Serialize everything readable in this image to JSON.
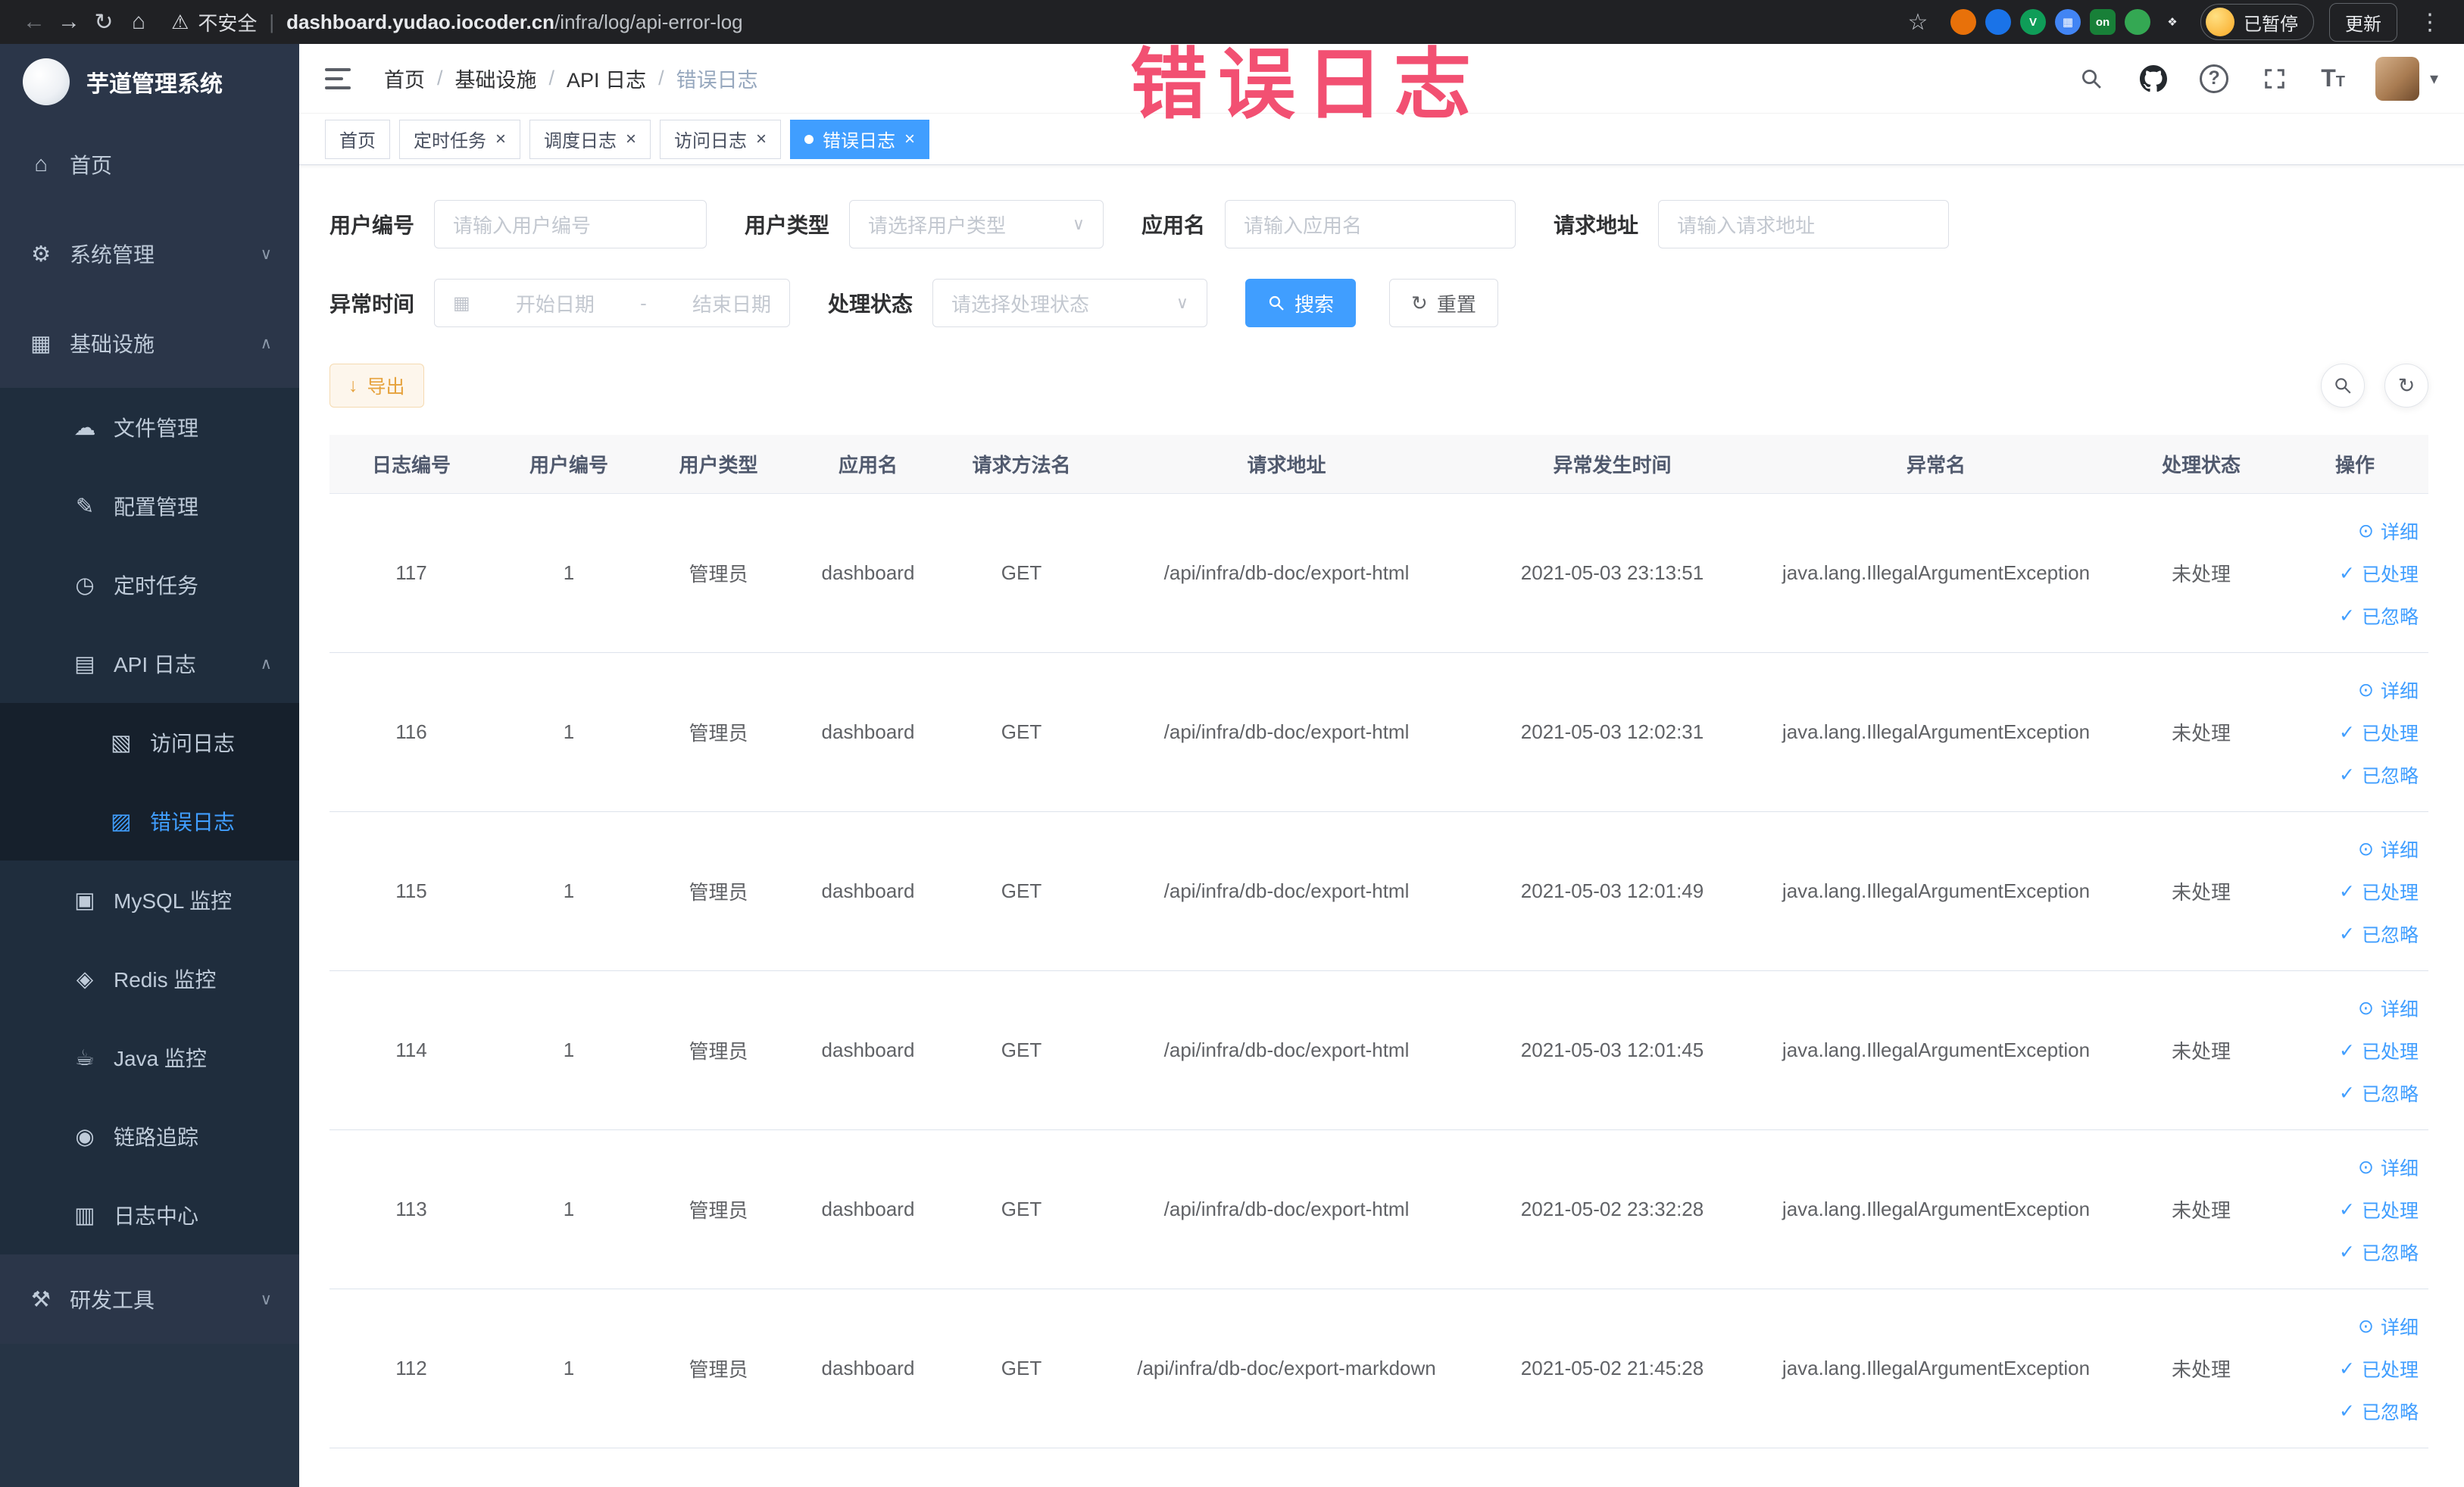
{
  "annotation": {
    "text": "错误日志"
  },
  "colors": {
    "primary": "#409EFF",
    "warning": "#E6A23C",
    "annotation": "#f25072"
  },
  "browser": {
    "security_label": "不安全",
    "url_domain": "dashboard.yudao.iocoder.cn",
    "url_path": "/infra/log/api-error-log",
    "paused_label": "已暂停",
    "update_label": "更新",
    "extensions": [
      {
        "name": "extension-orange-icon",
        "color": "#e8710a",
        "glyph": ""
      },
      {
        "name": "extension-blue-drop-icon",
        "color": "#1a73e8",
        "glyph": ""
      },
      {
        "name": "extension-green-v-icon",
        "color": "#0f9d58",
        "glyph": "V"
      },
      {
        "name": "extension-grid-icon",
        "color": "#4285f4",
        "glyph": "▦"
      },
      {
        "name": "extension-on-badge-icon",
        "color": "#188038",
        "glyph": "on",
        "shape": "square"
      },
      {
        "name": "extension-leaf-icon",
        "color": "#34a853",
        "glyph": ""
      },
      {
        "name": "extension-puzzle-icon",
        "color": "transparent",
        "glyph": "❖",
        "fg": "#e8eaed"
      }
    ]
  },
  "sidebar": {
    "logo_title": "芋道管理系统",
    "icon_glyphs": {
      "home-icon": "⌂",
      "gear-icon": "⚙",
      "infra-icon": "▦",
      "file-icon": "☁",
      "config-icon": "✎",
      "timer-icon": "◷",
      "api-log-icon": "▤",
      "access-log-icon": "▧",
      "error-log-icon": "▨",
      "mysql-icon": "▣",
      "redis-icon": "◈",
      "java-icon": "☕",
      "trace-icon": "◉",
      "logcenter-icon": "▥",
      "devtool-icon": "⚒"
    },
    "menu": [
      {
        "key": "home",
        "label": "首页",
        "icon": "home-icon",
        "level": 0
      },
      {
        "key": "system-mgmt",
        "label": "系统管理",
        "icon": "gear-icon",
        "level": 0,
        "chevron": "down"
      },
      {
        "key": "infrastructure",
        "label": "基础设施",
        "icon": "infra-icon",
        "level": 0,
        "chevron": "up"
      },
      {
        "key": "file-mgmt",
        "label": "文件管理",
        "icon": "file-icon",
        "level": 1
      },
      {
        "key": "config-mgmt",
        "label": "配置管理",
        "icon": "config-icon",
        "level": 1
      },
      {
        "key": "cron-job",
        "label": "定时任务",
        "icon": "timer-icon",
        "level": 1
      },
      {
        "key": "api-log",
        "label": "API 日志",
        "icon": "api-log-icon",
        "level": 1,
        "chevron": "up"
      },
      {
        "key": "access-log",
        "label": "访问日志",
        "icon": "access-log-icon",
        "level": 2
      },
      {
        "key": "error-log",
        "label": "错误日志",
        "icon": "error-log-icon",
        "level": 2,
        "active": true
      },
      {
        "key": "mysql-monitor",
        "label": "MySQL 监控",
        "icon": "mysql-icon",
        "level": 1
      },
      {
        "key": "redis-monitor",
        "label": "Redis 监控",
        "icon": "redis-icon",
        "level": 1
      },
      {
        "key": "java-monitor",
        "label": "Java 监控",
        "icon": "java-icon",
        "level": 1
      },
      {
        "key": "link-trace",
        "label": "链路追踪",
        "icon": "trace-icon",
        "level": 1
      },
      {
        "key": "log-center",
        "label": "日志中心",
        "icon": "logcenter-icon",
        "level": 1
      },
      {
        "key": "dev-tools",
        "label": "研发工具",
        "icon": "devtool-icon",
        "level": 0,
        "chevron": "down"
      }
    ]
  },
  "header": {
    "breadcrumb": [
      "首页",
      "基础设施",
      "API 日志",
      "错误日志"
    ]
  },
  "tabs": [
    {
      "key": "home",
      "label": "首页",
      "closable": false
    },
    {
      "key": "cron-job",
      "label": "定时任务",
      "closable": true
    },
    {
      "key": "schedule-log",
      "label": "调度日志",
      "closable": true
    },
    {
      "key": "access-log",
      "label": "访问日志",
      "closable": true
    },
    {
      "key": "error-log",
      "label": "错误日志",
      "closable": true,
      "active": true
    }
  ],
  "filters": {
    "user_id": {
      "label": "用户编号",
      "placeholder": "请输入用户编号"
    },
    "user_type": {
      "label": "用户类型",
      "placeholder": "请选择用户类型"
    },
    "app_name": {
      "label": "应用名",
      "placeholder": "请输入应用名"
    },
    "request_url": {
      "label": "请求地址",
      "placeholder": "请输入请求地址"
    },
    "exception_time": {
      "label": "异常时间",
      "start_placeholder": "开始日期",
      "separator": "-",
      "end_placeholder": "结束日期"
    },
    "process_status": {
      "label": "处理状态",
      "placeholder": "请选择处理状态"
    },
    "search_label": "搜索",
    "reset_label": "重置"
  },
  "toolbar": {
    "export_label": "导出"
  },
  "table": {
    "columns": [
      "日志编号",
      "用户编号",
      "用户类型",
      "应用名",
      "请求方法名",
      "请求地址",
      "异常发生时间",
      "异常名",
      "处理状态",
      "操作"
    ],
    "actions": {
      "detail": "详细",
      "processed": "已处理",
      "ignored": "已忽略"
    },
    "rows": [
      {
        "id": "117",
        "user_id": "1",
        "user_type": "管理员",
        "app": "dashboard",
        "method": "GET",
        "url": "/api/infra/db-doc/export-html",
        "time": "2021-05-03 23:13:51",
        "exception": "java.lang.IllegalArgumentException",
        "status": "未处理"
      },
      {
        "id": "116",
        "user_id": "1",
        "user_type": "管理员",
        "app": "dashboard",
        "method": "GET",
        "url": "/api/infra/db-doc/export-html",
        "time": "2021-05-03 12:02:31",
        "exception": "java.lang.IllegalArgumentException",
        "status": "未处理"
      },
      {
        "id": "115",
        "user_id": "1",
        "user_type": "管理员",
        "app": "dashboard",
        "method": "GET",
        "url": "/api/infra/db-doc/export-html",
        "time": "2021-05-03 12:01:49",
        "exception": "java.lang.IllegalArgumentException",
        "status": "未处理"
      },
      {
        "id": "114",
        "user_id": "1",
        "user_type": "管理员",
        "app": "dashboard",
        "method": "GET",
        "url": "/api/infra/db-doc/export-html",
        "time": "2021-05-03 12:01:45",
        "exception": "java.lang.IllegalArgumentException",
        "status": "未处理"
      },
      {
        "id": "113",
        "user_id": "1",
        "user_type": "管理员",
        "app": "dashboard",
        "method": "GET",
        "url": "/api/infra/db-doc/export-html",
        "time": "2021-05-02 23:32:28",
        "exception": "java.lang.IllegalArgumentException",
        "status": "未处理"
      },
      {
        "id": "112",
        "user_id": "1",
        "user_type": "管理员",
        "app": "dashboard",
        "method": "GET",
        "url": "/api/infra/db-doc/export-markdown",
        "time": "2021-05-02 21:45:28",
        "exception": "java.lang.IllegalArgumentException",
        "status": "未处理"
      }
    ]
  }
}
